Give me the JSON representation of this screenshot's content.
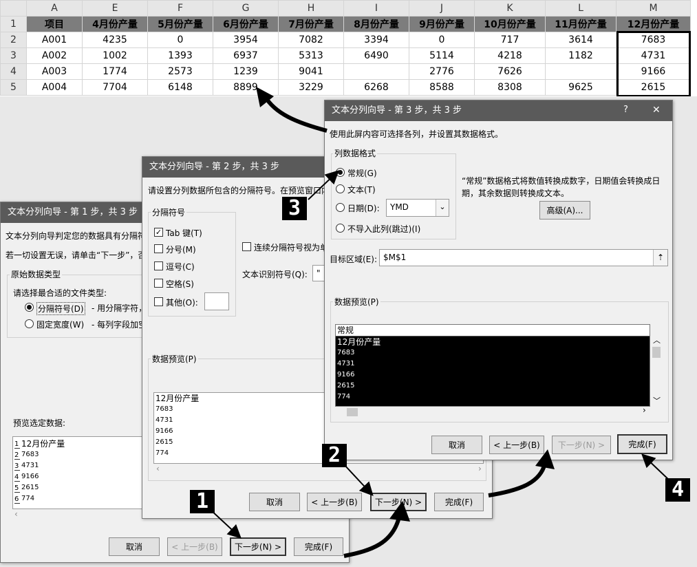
{
  "sheet": {
    "col_letters": [
      "",
      "A",
      "E",
      "F",
      "G",
      "H",
      "I",
      "J",
      "K",
      "L",
      "M"
    ],
    "header": [
      "项目",
      "4月份产量",
      "5月份产量",
      "6月份产量",
      "7月份产量",
      "8月份产量",
      "9月份产量",
      "10月份产量",
      "11月份产量",
      "12月份产量"
    ],
    "rows": [
      {
        "n": "2",
        "cells": [
          "A001",
          "4235",
          "0",
          "3954",
          "7082",
          "3394",
          "0",
          "717",
          "3614",
          "7683"
        ]
      },
      {
        "n": "3",
        "cells": [
          "A002",
          "1002",
          "1393",
          "6937",
          "5313",
          "6490",
          "5114",
          "4218",
          "1182",
          "4731"
        ]
      },
      {
        "n": "4",
        "cells": [
          "A003",
          "1774",
          "2573",
          "1239",
          "9041",
          "",
          "2776",
          "7626",
          "",
          "9166"
        ]
      },
      {
        "n": "5",
        "cells": [
          "A004",
          "7704",
          "6148",
          "8899",
          "3229",
          "6268",
          "8588",
          "8308",
          "9625",
          "2615"
        ]
      }
    ],
    "header_row_num": "1"
  },
  "step1": {
    "title": "文本分列向导 - 第 1 步，共 3 步",
    "desc1": "文本分列向导判定您的数据具有分隔符",
    "desc2": "若一切设置无误，请单击“下一步”，否",
    "group_title": "原始数据类型",
    "group_prompt": "请选择最合适的文件类型:",
    "opt_delimited": "分隔符号(D)",
    "opt_delimited_desc": "- 用分隔字符，",
    "opt_fixed": "固定宽度(W)",
    "opt_fixed_desc": "- 每列字段加空",
    "preview_label": "预览选定数据:",
    "preview_rows": [
      {
        "n": "1",
        "text": "12月份产量"
      },
      {
        "n": "2",
        "text": "7683"
      },
      {
        "n": "3",
        "text": "4731"
      },
      {
        "n": "4",
        "text": "9166"
      },
      {
        "n": "5",
        "text": "2615"
      },
      {
        "n": "6",
        "text": "774"
      }
    ],
    "btn_cancel": "取消",
    "btn_back": "< 上一步(B)",
    "btn_next": "下一步(N) >",
    "btn_finish": "完成(F)"
  },
  "step2": {
    "title": "文本分列向导 - 第 2 步，共 3 步",
    "desc": "请设置分列数据所包含的分隔符号。在预览窗口内",
    "group_title": "分隔符号",
    "chk_tab": "Tab 键(T)",
    "chk_semicolon": "分号(M)",
    "chk_comma": "逗号(C)",
    "chk_space": "空格(S)",
    "chk_other": "其他(O):",
    "chk_consecutive": "连续分隔符号视为单",
    "qualifier_label": "文本识别符号(Q):",
    "qualifier_value": "\"",
    "preview_label": "数据预览(P)",
    "preview_lines": [
      "12月份产量",
      "7683",
      "4731",
      "9166",
      "2615",
      "774"
    ],
    "btn_cancel": "取消",
    "btn_back": "< 上一步(B)",
    "btn_next": "下一步(N) >",
    "btn_finish": "完成(F)"
  },
  "step3": {
    "title": "文本分列向导 - 第 3 步，共 3 步",
    "help": "?",
    "close": "✕",
    "desc": "使用此屏内容可选择各列，并设置其数据格式。",
    "group_title": "列数据格式",
    "opt_general": "常规(G)",
    "opt_text": "文本(T)",
    "opt_date": "日期(D):",
    "date_value": "YMD",
    "opt_skip": "不导入此列(跳过)(I)",
    "general_note1": "“常规”数据格式将数值转换成数字，日期值会转换成日",
    "general_note2": "期，其余数据则转换成文本。",
    "btn_advanced": "高级(A)...",
    "dest_label": "目标区域(E):",
    "dest_value": "$M$1",
    "preview_label": "数据预览(P)",
    "preview_header": "常规",
    "preview_lines": [
      "12月份产量",
      "7683",
      "4731",
      "9166",
      "2615",
      "774"
    ],
    "btn_cancel": "取消",
    "btn_back": "< 上一步(B)",
    "btn_next": "下一步(N) >",
    "btn_finish": "完成(F)"
  },
  "badges": {
    "b1": "1",
    "b2": "2",
    "b3": "3",
    "b4": "4"
  }
}
